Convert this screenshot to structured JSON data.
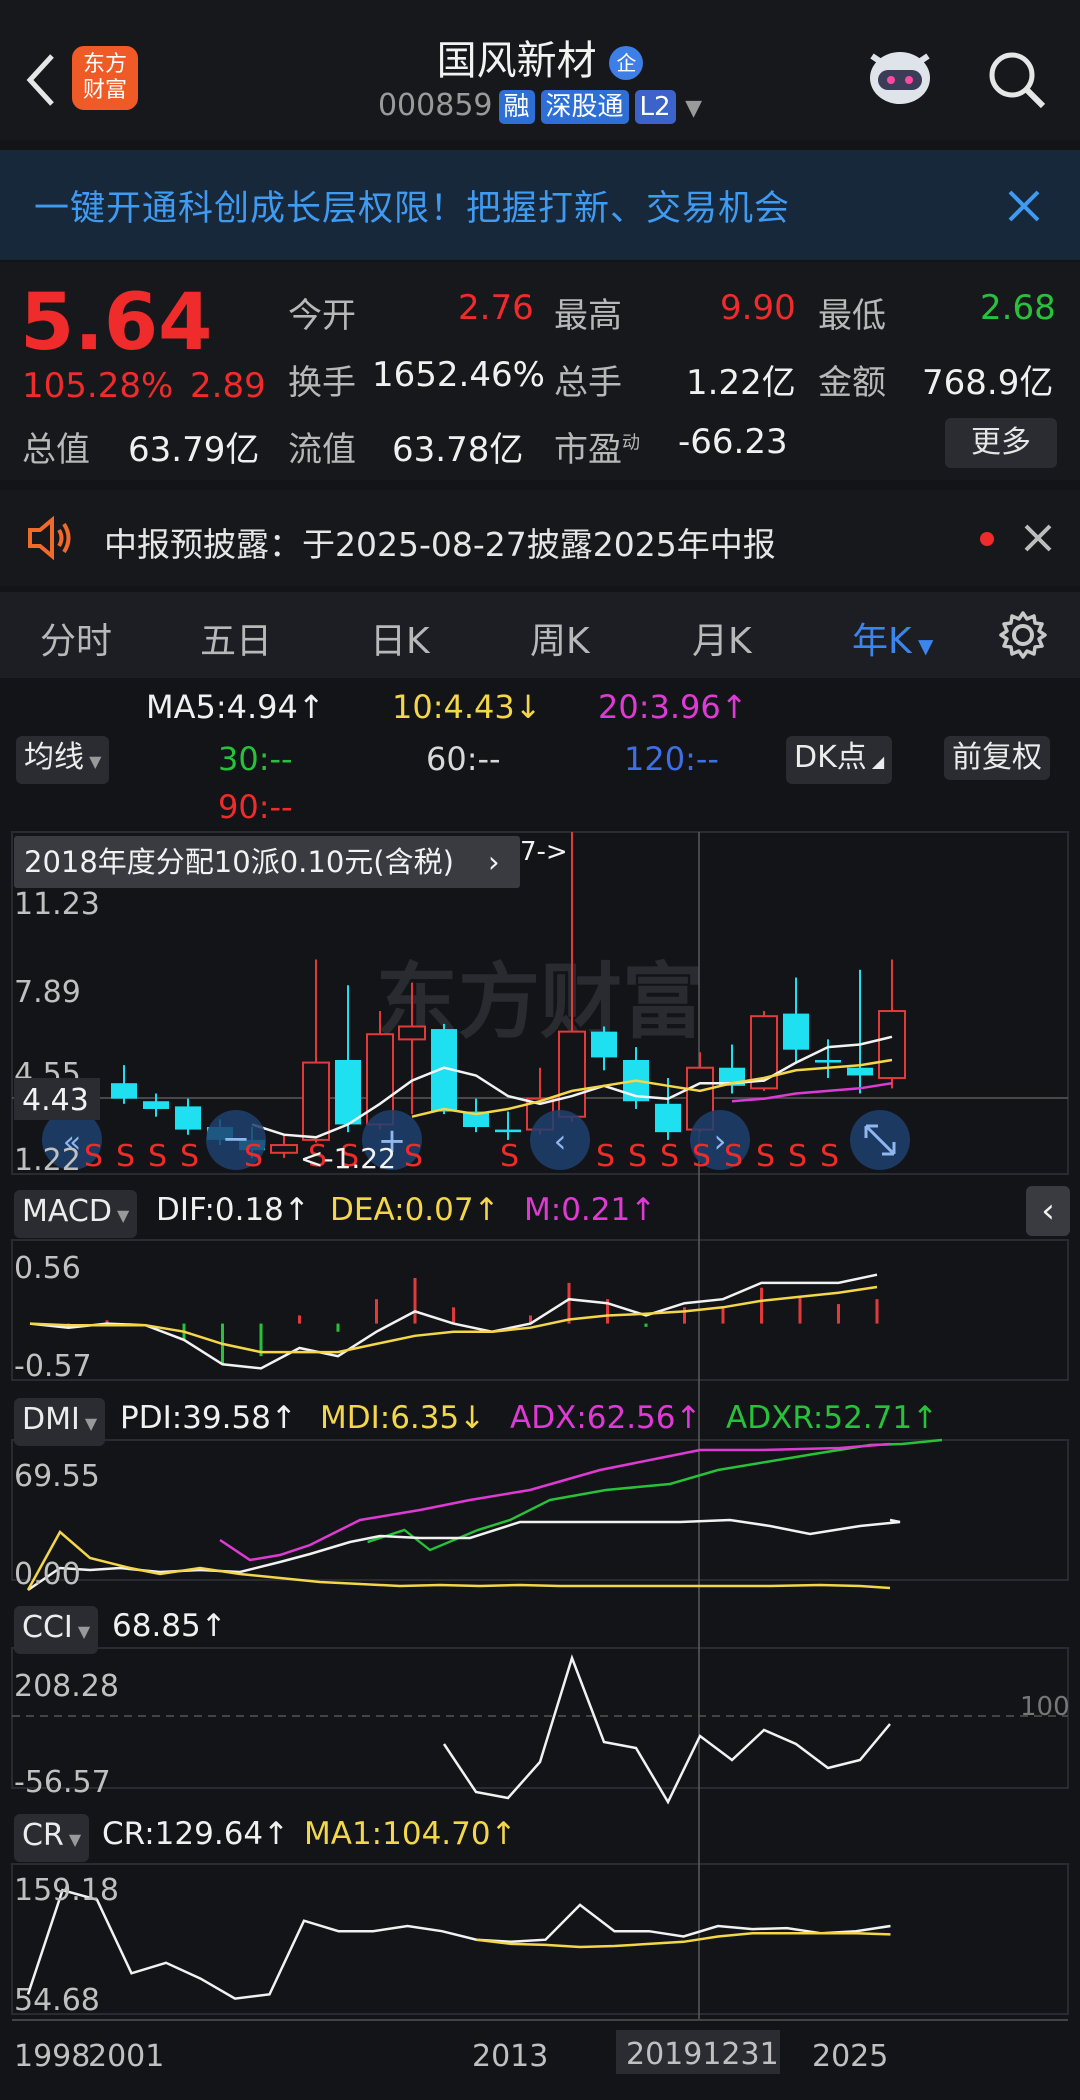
{
  "header": {
    "title": "国风新材",
    "title_badge": "企",
    "code": "000859",
    "tags": [
      "融",
      "深股通",
      "L2"
    ],
    "logo_line1": "东方",
    "logo_line2": "财富"
  },
  "banner": {
    "text": "一键开通科创成长层权限！把握打新、交易机会"
  },
  "quote": {
    "price": "5.64",
    "change_pct": "105.28%",
    "change": "2.89",
    "open_label": "今开",
    "open": "2.76",
    "high_label": "最高",
    "high": "9.90",
    "low_label": "最低",
    "low": "2.68",
    "turnover_label": "换手",
    "turnover": "1652.46%",
    "volume_label": "总手",
    "volume": "1.22亿",
    "amount_label": "金额",
    "amount": "768.9亿",
    "mktcap_label": "总值",
    "mktcap": "63.79亿",
    "float_label": "流值",
    "float": "63.78亿",
    "pe_label": "市盈",
    "pe_sup": "动",
    "pe": "-66.23",
    "more_label": "更多"
  },
  "notice": {
    "text": "中报预披露：于2025-08-27披露2025年中报"
  },
  "tabs": [
    {
      "label": "分时"
    },
    {
      "label": "五日"
    },
    {
      "label": "日K"
    },
    {
      "label": "周K"
    },
    {
      "label": "月K"
    },
    {
      "label": "年K"
    }
  ],
  "ma": {
    "btn": "均线",
    "ma5": "MA5:4.94↑",
    "ma10": "10:4.43↓",
    "ma20": "20:3.96↑",
    "ma30": "30:--",
    "ma60": "60:--",
    "ma120": "120:--",
    "ma90": "90:--",
    "dk": "DK点",
    "fq": "前复权"
  },
  "kline": {
    "event": "2018年度分配10派0.10元(含税)",
    "event_tail": "7->",
    "y_labels": [
      "11.23",
      "7.89",
      "4.55",
      "1.22"
    ],
    "crosshair_price": "4.43",
    "low_marker": "1.22",
    "signal": "S",
    "watermark": "东方财富"
  },
  "macd": {
    "btn": "MACD",
    "dif": "DIF:0.18↑",
    "dea": "DEA:0.07↑",
    "m": "M:0.21↑",
    "y_top": "0.56",
    "y_bot": "-0.57"
  },
  "dmi": {
    "btn": "DMI",
    "pdi": "PDI:39.58↑",
    "mdi": "MDI:6.35↓",
    "adx": "ADX:62.56↑",
    "adxr": "ADXR:52.71↑",
    "y_top": "69.55",
    "y_bot": "0.00"
  },
  "cci": {
    "btn": "CCI",
    "val": "68.85↑",
    "y_top": "208.28",
    "y_bot": "-56.57",
    "ref": "100"
  },
  "cr": {
    "btn": "CR",
    "cr": "CR:129.64↑",
    "ma1": "MA1:104.70↑",
    "y_top": "159.18",
    "y_bot": "54.68"
  },
  "xaxis": {
    "labels": [
      "1998",
      "2001",
      "2013",
      "2019",
      "2025"
    ],
    "cursor_date": "20191231"
  },
  "chart_data": {
    "type": "candlestick",
    "candles": [
      {
        "o": 4.2,
        "c": 3.6,
        "h": 4.9,
        "l": 3.4
      },
      {
        "o": 3.5,
        "c": 3.2,
        "h": 3.8,
        "l": 2.9
      },
      {
        "o": 3.3,
        "c": 2.4,
        "h": 3.6,
        "l": 2.2
      },
      {
        "o": 2.5,
        "c": 2.0,
        "h": 2.8,
        "l": 1.8
      },
      {
        "o": 2.0,
        "c": 1.6,
        "h": 2.5,
        "l": 1.3
      },
      {
        "o": 1.5,
        "c": 1.8,
        "h": 2.2,
        "l": 1.3
      },
      {
        "o": 2.0,
        "c": 5.0,
        "h": 9.0,
        "l": 1.9
      },
      {
        "o": 5.1,
        "c": 2.6,
        "h": 8.0,
        "l": 2.3
      },
      {
        "o": 2.6,
        "c": 6.1,
        "h": 7.0,
        "l": 2.4
      },
      {
        "o": 5.9,
        "c": 6.4,
        "h": 8.1,
        "l": 3.0
      },
      {
        "o": 6.3,
        "c": 3.1,
        "h": 6.5,
        "l": 3.0
      },
      {
        "o": 3.1,
        "c": 2.5,
        "h": 3.6,
        "l": 2.3
      },
      {
        "o": 2.4,
        "c": 2.3,
        "h": 3.1,
        "l": 2.0
      },
      {
        "o": 2.4,
        "c": 3.6,
        "h": 4.8,
        "l": 2.2
      },
      {
        "o": 2.9,
        "c": 6.2,
        "h": 19.0,
        "l": 2.7
      },
      {
        "o": 6.2,
        "c": 5.2,
        "h": 6.4,
        "l": 4.7
      },
      {
        "o": 5.1,
        "c": 3.5,
        "h": 5.6,
        "l": 3.2
      },
      {
        "o": 3.4,
        "c": 2.3,
        "h": 4.4,
        "l": 2.0
      },
      {
        "o": 2.4,
        "c": 4.8,
        "h": 5.4,
        "l": 2.3
      },
      {
        "o": 4.8,
        "c": 4.1,
        "h": 5.7,
        "l": 3.8
      },
      {
        "o": 4.0,
        "c": 6.8,
        "h": 7.0,
        "l": 3.9
      },
      {
        "o": 6.9,
        "c": 5.5,
        "h": 8.3,
        "l": 5.0
      },
      {
        "o": 5.1,
        "c": 5.0,
        "h": 5.9,
        "l": 4.4
      },
      {
        "o": 4.8,
        "c": 4.5,
        "h": 8.6,
        "l": 3.8
      },
      {
        "o": 4.4,
        "c": 7.0,
        "h": 9.0,
        "l": 4.0
      }
    ],
    "ma5": [
      null,
      null,
      null,
      null,
      2.6,
      2.2,
      2.1,
      2.6,
      3.4,
      4.3,
      4.8,
      4.5,
      3.7,
      3.4,
      3.7,
      4.1,
      3.7,
      3.6,
      4.2,
      4.2,
      4.3,
      5.0,
      5.6,
      5.7,
      6.0
    ],
    "ma10": [
      null,
      null,
      null,
      null,
      null,
      null,
      null,
      null,
      null,
      2.9,
      3.2,
      3.0,
      3.2,
      3.5,
      3.9,
      4.1,
      4.3,
      4.1,
      3.9,
      4.2,
      4.4,
      4.7,
      4.8,
      4.9,
      5.1
    ],
    "ma20": [
      null,
      null,
      null,
      null,
      null,
      null,
      null,
      null,
      null,
      null,
      null,
      null,
      null,
      null,
      null,
      null,
      null,
      null,
      null,
      3.5,
      3.6,
      3.8,
      3.9,
      4.0,
      4.2
    ],
    "macd": {
      "dif": [
        0.0,
        -0.05,
        0.0,
        -0.02,
        -0.2,
        -0.5,
        -0.55,
        -0.3,
        -0.4,
        -0.1,
        0.15,
        0.0,
        -0.1,
        0.0,
        0.3,
        0.25,
        0.1,
        0.25,
        0.3,
        0.5,
        0.5,
        0.5,
        0.6
      ],
      "dea": [
        0.0,
        -0.02,
        -0.02,
        -0.02,
        -0.1,
        -0.25,
        -0.35,
        -0.35,
        -0.35,
        -0.25,
        -0.15,
        -0.1,
        -0.1,
        -0.05,
        0.05,
        0.1,
        0.12,
        0.15,
        0.2,
        0.28,
        0.33,
        0.38,
        0.45
      ]
    },
    "cr": {
      "cr": [
        60,
        159,
        150,
        80,
        90,
        75,
        56,
        60,
        130,
        120,
        120,
        125,
        120,
        112,
        110,
        112,
        145,
        120,
        120,
        115,
        125,
        122,
        123,
        118,
        120,
        125
      ],
      "ma1": [
        null,
        null,
        null,
        null,
        null,
        null,
        null,
        null,
        null,
        null,
        null,
        null,
        null,
        112,
        108,
        107,
        105,
        106,
        108,
        110,
        115,
        118,
        118,
        118,
        118,
        117
      ]
    }
  }
}
